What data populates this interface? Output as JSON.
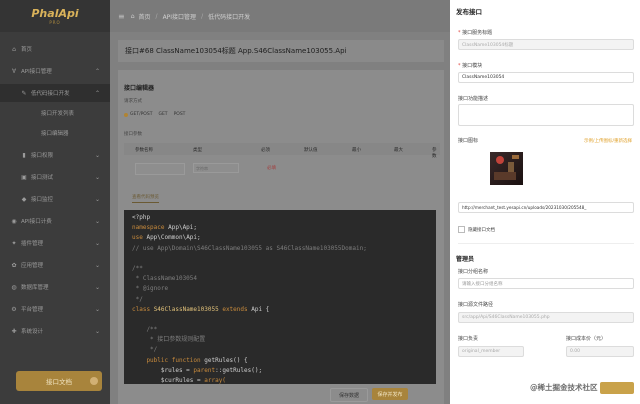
{
  "sidebar": {
    "logo": "PhalApi",
    "logo_sub": "PRO",
    "items": [
      {
        "label": "首页",
        "icon": "home-icon",
        "glyph": "⌂",
        "level": 0
      },
      {
        "label": "API接口管理",
        "icon": "api-icon",
        "glyph": "∀",
        "level": 0,
        "expanded": true
      },
      {
        "label": "低代码接口开发",
        "icon": "code-icon",
        "glyph": "✎",
        "level": 1,
        "expanded": true
      },
      {
        "label": "接口开发列表",
        "icon": "",
        "glyph": "",
        "level": 2
      },
      {
        "label": "接口编辑器",
        "icon": "",
        "glyph": "",
        "level": 2
      },
      {
        "label": "接口权限",
        "icon": "lock-icon",
        "glyph": "▮",
        "level": 1
      },
      {
        "label": "接口测试",
        "icon": "test-icon",
        "glyph": "▣",
        "level": 1
      },
      {
        "label": "接口监控",
        "icon": "monitor-icon",
        "glyph": "◆",
        "level": 1
      },
      {
        "label": "API接口计费",
        "icon": "billing-icon",
        "glyph": "◉",
        "level": 0
      },
      {
        "label": "插件管理",
        "icon": "plugin-icon",
        "glyph": "✦",
        "level": 0
      },
      {
        "label": "应用管理",
        "icon": "app-icon",
        "glyph": "✿",
        "level": 0
      },
      {
        "label": "数据库管理",
        "icon": "database-icon",
        "glyph": "◍",
        "level": 0
      },
      {
        "label": "平台管理",
        "icon": "platform-icon",
        "glyph": "⚙",
        "level": 0
      },
      {
        "label": "系统设计",
        "icon": "design-icon",
        "glyph": "✚",
        "level": 0
      }
    ],
    "doc_button": "接口文档"
  },
  "topbar": {
    "crumbs": [
      "首页",
      "API接口管理",
      "低代码接口开发"
    ],
    "home_glyph": "⌂"
  },
  "main": {
    "title": "接口#68 ClassName103054标题 App.S46ClassName103055.Api",
    "editor_title": "接口编辑器",
    "request_method_label": "请求方式",
    "methods": [
      "GET/POST",
      "GET",
      "POST"
    ],
    "params_label": "接口参数",
    "columns": [
      "参数名称",
      "类型",
      "必须",
      "默认值",
      "最小",
      "最大",
      "参数"
    ],
    "row_type": "字符串",
    "row_required": "必填",
    "code_tab": "查看代码预览",
    "code_lines": [
      [
        {
          "t": "<?php",
          "c": "#cfcfcf"
        }
      ],
      [
        {
          "t": "namespace ",
          "c": "#c98b3c"
        },
        {
          "t": "App\\Api;",
          "c": "#cfcfcf"
        }
      ],
      [
        {
          "t": "use ",
          "c": "#c98b3c"
        },
        {
          "t": "App\\Common\\Api;",
          "c": "#cfcfcf"
        }
      ],
      [
        {
          "t": "// use App\\Domain\\S46ClassName103055 as S46ClassName103055Domain;",
          "c": "#7d7d7d"
        }
      ],
      [
        {
          "t": "",
          "c": "#cfcfcf"
        }
      ],
      [
        {
          "t": "/**",
          "c": "#7d7d7d"
        }
      ],
      [
        {
          "t": " * ClassName103054",
          "c": "#7d7d7d"
        }
      ],
      [
        {
          "t": " * @ignore",
          "c": "#7d7d7d"
        }
      ],
      [
        {
          "t": " */",
          "c": "#7d7d7d"
        }
      ],
      [
        {
          "t": "class ",
          "c": "#c98b3c"
        },
        {
          "t": "S46ClassName103055 ",
          "c": "#e2c27a"
        },
        {
          "t": "extends ",
          "c": "#c98b3c"
        },
        {
          "t": "Api {",
          "c": "#cfcfcf"
        }
      ],
      [
        {
          "t": "",
          "c": "#cfcfcf"
        }
      ],
      [
        {
          "t": "    /**",
          "c": "#7d7d7d"
        }
      ],
      [
        {
          "t": "     * 接口参数规则配置",
          "c": "#7d7d7d"
        }
      ],
      [
        {
          "t": "     */",
          "c": "#7d7d7d"
        }
      ],
      [
        {
          "t": "    public ",
          "c": "#c98b3c"
        },
        {
          "t": "function ",
          "c": "#c98b3c"
        },
        {
          "t": "getRules() {",
          "c": "#cfcfcf"
        }
      ],
      [
        {
          "t": "        $rules = ",
          "c": "#cfcfcf"
        },
        {
          "t": "parent",
          "c": "#c98b3c"
        },
        {
          "t": "::getRules();",
          "c": "#cfcfcf"
        }
      ],
      [
        {
          "t": "        $curRules = ",
          "c": "#cfcfcf"
        },
        {
          "t": "array(",
          "c": "#c98b3c"
        }
      ]
    ],
    "bottom_buttons": [
      "保存数据",
      "保存并发布"
    ]
  },
  "drawer": {
    "title": "发布接口",
    "api_title_label": "接口服务标题",
    "api_title_value": "ClassName103054标题",
    "module_label": "接口模块",
    "module_value": "ClassName103054",
    "desc_label": "接口功能描述",
    "icon_label": "接口图标",
    "icon_hint": "示例/上传图标/重新选择",
    "icon_url": "http://merchant_test.yesapi.cn/uploads/20231030/205548_",
    "hide_doc_label": "隐藏接口文档",
    "admin_section": "管理员",
    "group_label": "接口分组名称",
    "group_placeholder": "请输入接口分组名称",
    "path_label": "接口源文件路径",
    "path_value": "src/app/Api/S46ClassName103055.php",
    "owner_label": "接口负责",
    "owner_value": "original_member",
    "cost_label": "接口成本价（元）",
    "cost_value": "0.00"
  },
  "watermark": "@稀土掘金技术社区"
}
